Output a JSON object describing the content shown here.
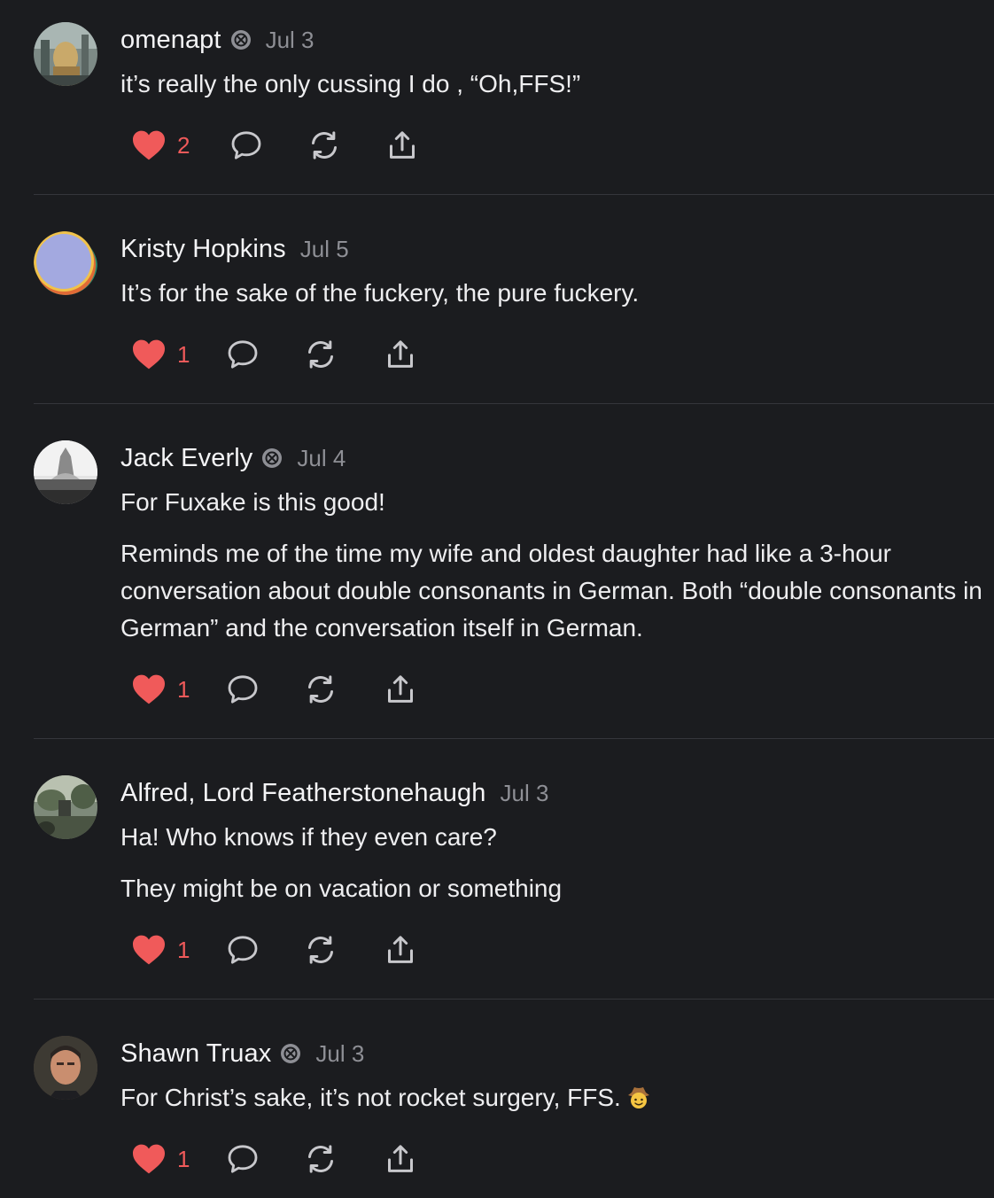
{
  "comments": [
    {
      "author": "omenapt",
      "badge": "subscriber-badge-icon",
      "date": "Jul 3",
      "paragraphs": [
        "it’s really the only cussing I do , “Oh,FFS!”"
      ],
      "likes": "2"
    },
    {
      "author": "Kristy Hopkins",
      "badge": null,
      "date": "Jul 5",
      "paragraphs": [
        "It’s for the sake of the fuckery, the pure fuckery."
      ],
      "likes": "1"
    },
    {
      "author": "Jack Everly",
      "badge": "subscriber-badge-icon",
      "date": "Jul 4",
      "paragraphs": [
        "For Fuxake is this good!",
        "Reminds me of the time my wife and oldest daughter had like a 3-hour conversation about double consonants in German. Both “double consonants in German” and the conversation itself in German."
      ],
      "likes": "1"
    },
    {
      "author": "Alfred, Lord Featherstonehaugh",
      "badge": null,
      "date": "Jul 3",
      "paragraphs": [
        "Ha! Who knows if they even care?",
        "They might be on vacation or something"
      ],
      "likes": "1"
    },
    {
      "author": "Shawn Truax",
      "badge": "subscriber-badge-icon",
      "date": "Jul 3",
      "paragraphs": [
        "For Christ’s sake, it’s not rocket surgery, FFS."
      ],
      "emoji": "cowboy-face-icon",
      "likes": "1"
    }
  ],
  "colors": {
    "background": "#1b1c1f",
    "like": "#f05a5a",
    "muted": "#8e8f95",
    "divider": "#35363b"
  }
}
